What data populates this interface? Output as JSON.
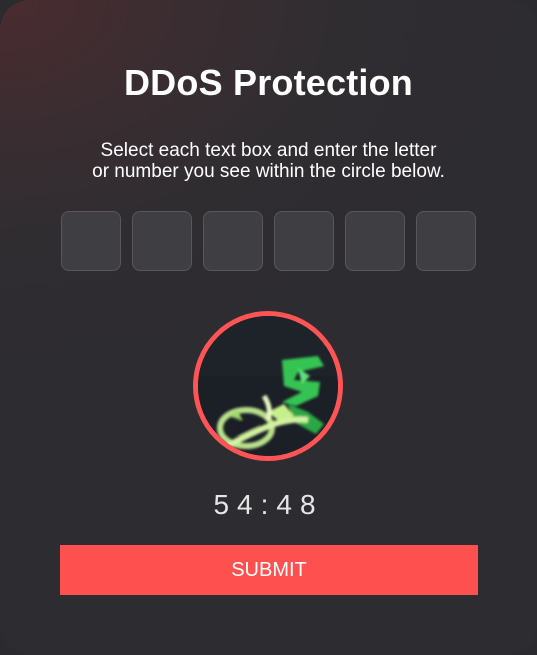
{
  "title": "DDoS Protection",
  "instructions": {
    "line1": "Select each text box and enter the letter",
    "line2": "or number you see within the circle below."
  },
  "inputs": {
    "count": 6,
    "values": [
      "",
      "",
      "",
      "",
      "",
      ""
    ]
  },
  "timer": "54:48",
  "submit_label": "SUBMIT",
  "colors": {
    "accent": "#ff5050",
    "background": "#2d2c30",
    "input_bg": "#3f3e43",
    "text": "#ffffff"
  }
}
